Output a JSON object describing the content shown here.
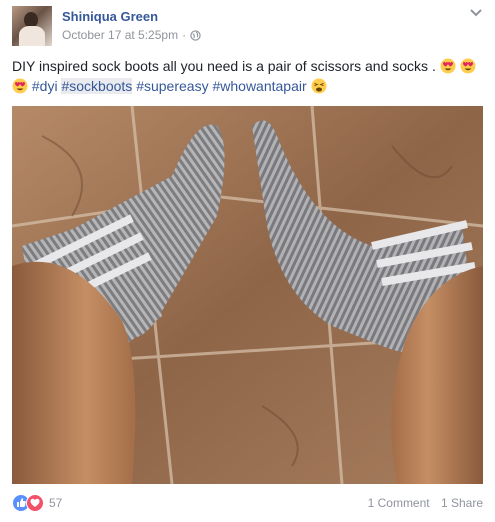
{
  "post": {
    "author": "Shiniqua Green",
    "timestamp": "October 17 at 5:25pm",
    "separator": "·",
    "privacy_icon": "globe-icon",
    "menu_icon": "chevron-down-icon",
    "text_line1": "DIY inspired sock boots all you need is a pair of scissors and socks .",
    "hashtags": [
      "#dyi",
      "#sockboots",
      "#supereasy",
      "#whowantapair"
    ],
    "photo_description_icon": "photo-of-legs-in-striped-socks"
  },
  "footer": {
    "reaction_icons": [
      "like-icon",
      "love-icon"
    ],
    "reaction_count": "57",
    "comments": "1 Comment",
    "shares": "1 Share"
  },
  "colors": {
    "link": "#365899",
    "meta": "#90949c",
    "like": "#5890ff",
    "love": "#f25268"
  }
}
